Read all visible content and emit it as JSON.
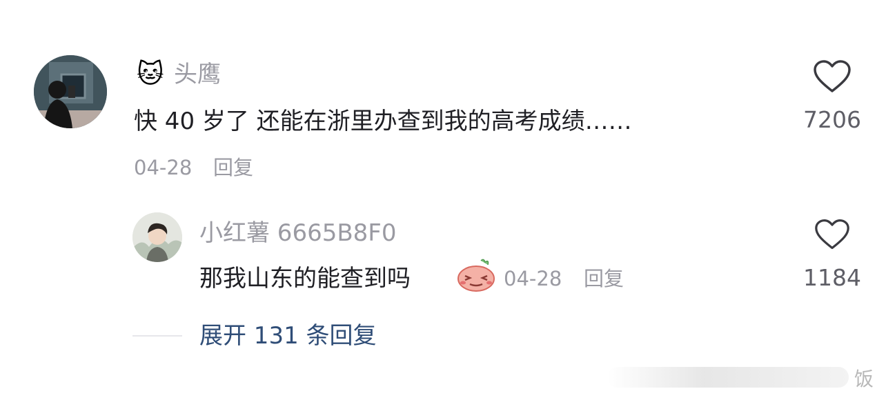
{
  "comment": {
    "avatar_icon": "user-avatar",
    "name_emoji": "🐱",
    "username": "头鹰",
    "text": "快 40 岁了 还能在浙里办查到我的高考成绩……",
    "date": "04-28",
    "reply_label": "回复",
    "like_icon": "heart-icon",
    "like_count": "7206"
  },
  "reply": {
    "avatar_icon": "user-avatar",
    "username": "小红薯 6665B8F0",
    "text": "那我山东的能查到吗",
    "emoji_icon": "sweat-potato-emoji",
    "date": "04-28",
    "reply_label": "回复",
    "like_icon": "heart-icon",
    "like_count": "1184"
  },
  "expand_label": "展开 131 条回复",
  "watermark": "饭"
}
